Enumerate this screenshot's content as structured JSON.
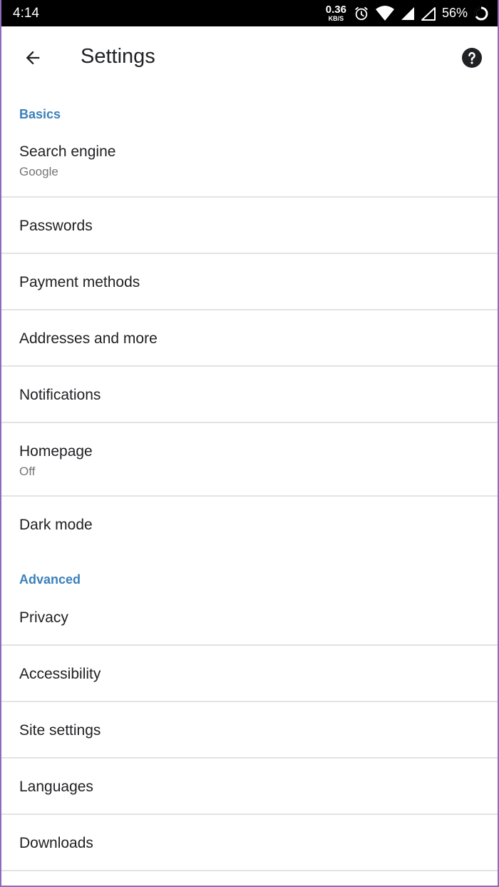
{
  "status_bar": {
    "time": "4:14",
    "net_speed_value": "0.36",
    "net_speed_unit": "KB/S",
    "battery_percent": "56%",
    "icons": [
      "alarm-icon",
      "wifi-icon",
      "signal-icon",
      "signal-empty-icon",
      "battery-icon"
    ]
  },
  "app_bar": {
    "title": "Settings"
  },
  "sections": {
    "basics": "Basics",
    "advanced": "Advanced"
  },
  "items": {
    "search_engine": {
      "label": "Search engine",
      "summary": "Google"
    },
    "passwords": {
      "label": "Passwords"
    },
    "payment_methods": {
      "label": "Payment methods"
    },
    "addresses": {
      "label": "Addresses and more"
    },
    "notifications": {
      "label": "Notifications"
    },
    "homepage": {
      "label": "Homepage",
      "summary": "Off"
    },
    "dark_mode": {
      "label": "Dark mode"
    },
    "privacy": {
      "label": "Privacy"
    },
    "accessibility": {
      "label": "Accessibility"
    },
    "site_settings": {
      "label": "Site settings"
    },
    "languages": {
      "label": "Languages"
    },
    "downloads": {
      "label": "Downloads"
    }
  },
  "colors": {
    "accent": "#3b80ba",
    "text_primary": "#202124",
    "text_secondary": "#757575",
    "divider": "#e3e3e3",
    "status_bar": "#000000"
  }
}
